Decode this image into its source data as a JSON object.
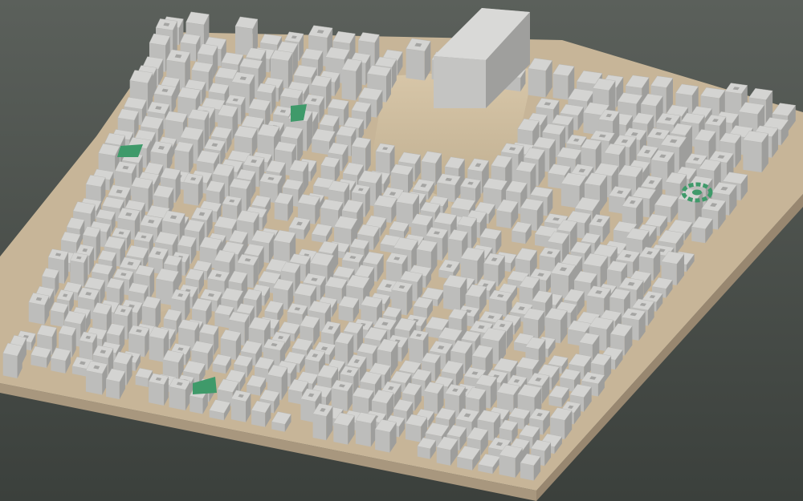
{
  "scene": {
    "kind": "3d-city-block-model",
    "background_gradient": [
      "#5a5f5a",
      "#3a3f3b"
    ],
    "base_color": "#b8a78f",
    "base_side_color": "#a9977d",
    "ground_color": "#c9b89c",
    "building_top_color": "#d4d4d2",
    "building_side_light": "#bdbdbb",
    "building_side_dark": "#9e9e9c",
    "park_color": "#3f9a6a",
    "landmark": "circular-green-roundabout",
    "plaza": "open-square-central"
  }
}
